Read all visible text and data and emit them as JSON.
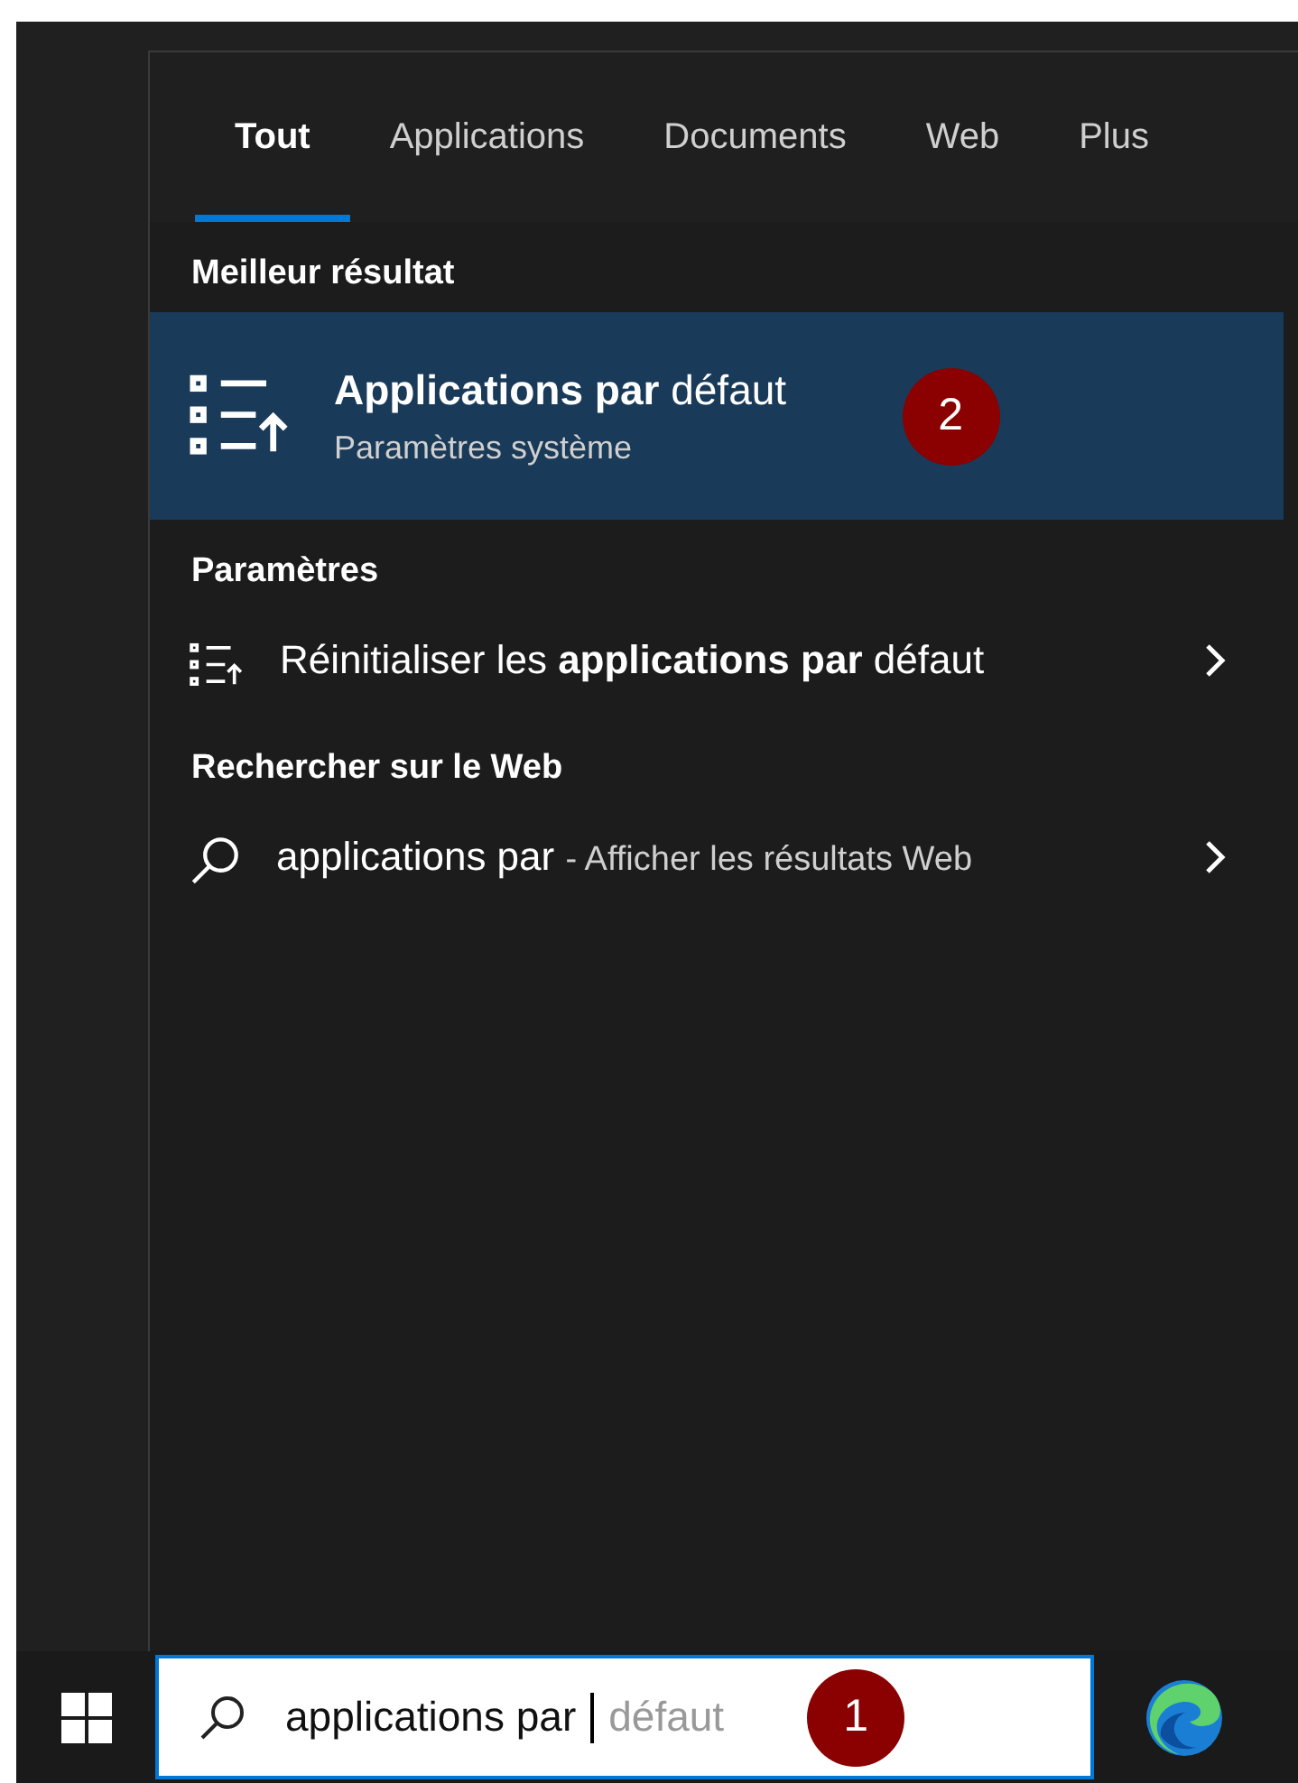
{
  "tabs": [
    {
      "label": "Tout",
      "selected": true
    },
    {
      "label": "Applications",
      "selected": false
    },
    {
      "label": "Documents",
      "selected": false
    },
    {
      "label": "Web",
      "selected": false
    },
    {
      "label": "Plus",
      "selected": false
    }
  ],
  "sections": [
    {
      "title": "Meilleur résultat",
      "items": [
        {
          "kind": "best",
          "title": "**Applications par** défaut",
          "subtitle": "Paramètres système",
          "selected": true,
          "badge": "2"
        }
      ]
    },
    {
      "title": "Paramètres",
      "items": [
        {
          "kind": "setting",
          "title": "Réinitialiser les **applications par** défaut",
          "selected": false
        }
      ]
    },
    {
      "title": "Rechercher sur le Web",
      "items": [
        {
          "kind": "web",
          "query": "applications par",
          "suffix": "- Afficher les résultats Web",
          "selected": false
        }
      ]
    }
  ],
  "taskbar": {
    "search": {
      "value": "applications par",
      "suggestion": "défaut",
      "badge": "1"
    }
  }
}
